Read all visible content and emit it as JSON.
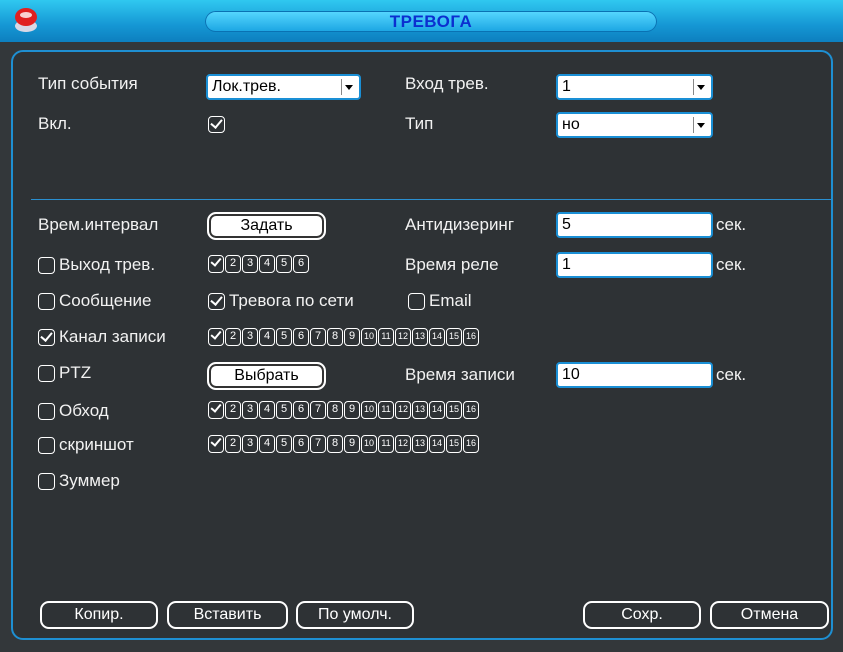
{
  "window": {
    "title": "ТРЕВОГА"
  },
  "event_type": {
    "label": "Тип события",
    "value": "Лок.трев."
  },
  "alarm_input": {
    "label": "Вход трев.",
    "value": "1"
  },
  "enable": {
    "label": "Вкл.",
    "checked": true
  },
  "type": {
    "label": "Тип",
    "value": "но"
  },
  "period": {
    "label": "Врем.интервал",
    "button": "Задать"
  },
  "antidither": {
    "label": "Антидизеринг",
    "value": "5",
    "unit": "сек."
  },
  "alarm_out": {
    "label": "Выход трев.",
    "checked": false,
    "channels": [
      "1",
      "2",
      "3",
      "4",
      "5",
      "6"
    ]
  },
  "relay_time": {
    "label": "Время реле",
    "value": "1",
    "unit": "сек."
  },
  "message": {
    "label": "Сообщение",
    "checked": false
  },
  "net_alarm": {
    "label": "Тревога по сети",
    "checked": true
  },
  "email": {
    "label": "Email",
    "checked": false
  },
  "record_channel": {
    "label": "Канал записи",
    "checked": true
  },
  "ptz": {
    "label": "PTZ",
    "checked": false,
    "button": "Выбрать"
  },
  "record_time": {
    "label": "Время записи",
    "value": "10",
    "unit": "сек."
  },
  "tour": {
    "label": "Обход",
    "checked": false
  },
  "snapshot": {
    "label": "скриншот",
    "checked": false
  },
  "buzzer": {
    "label": "Зуммер",
    "checked": false
  },
  "channels16": [
    "1",
    "2",
    "3",
    "4",
    "5",
    "6",
    "7",
    "8",
    "9",
    "10",
    "11",
    "12",
    "13",
    "14",
    "15",
    "16"
  ],
  "buttons": {
    "copy": "Копир.",
    "paste": "Вставить",
    "default": "По умолч.",
    "save": "Сохр.",
    "cancel": "Отмена"
  }
}
